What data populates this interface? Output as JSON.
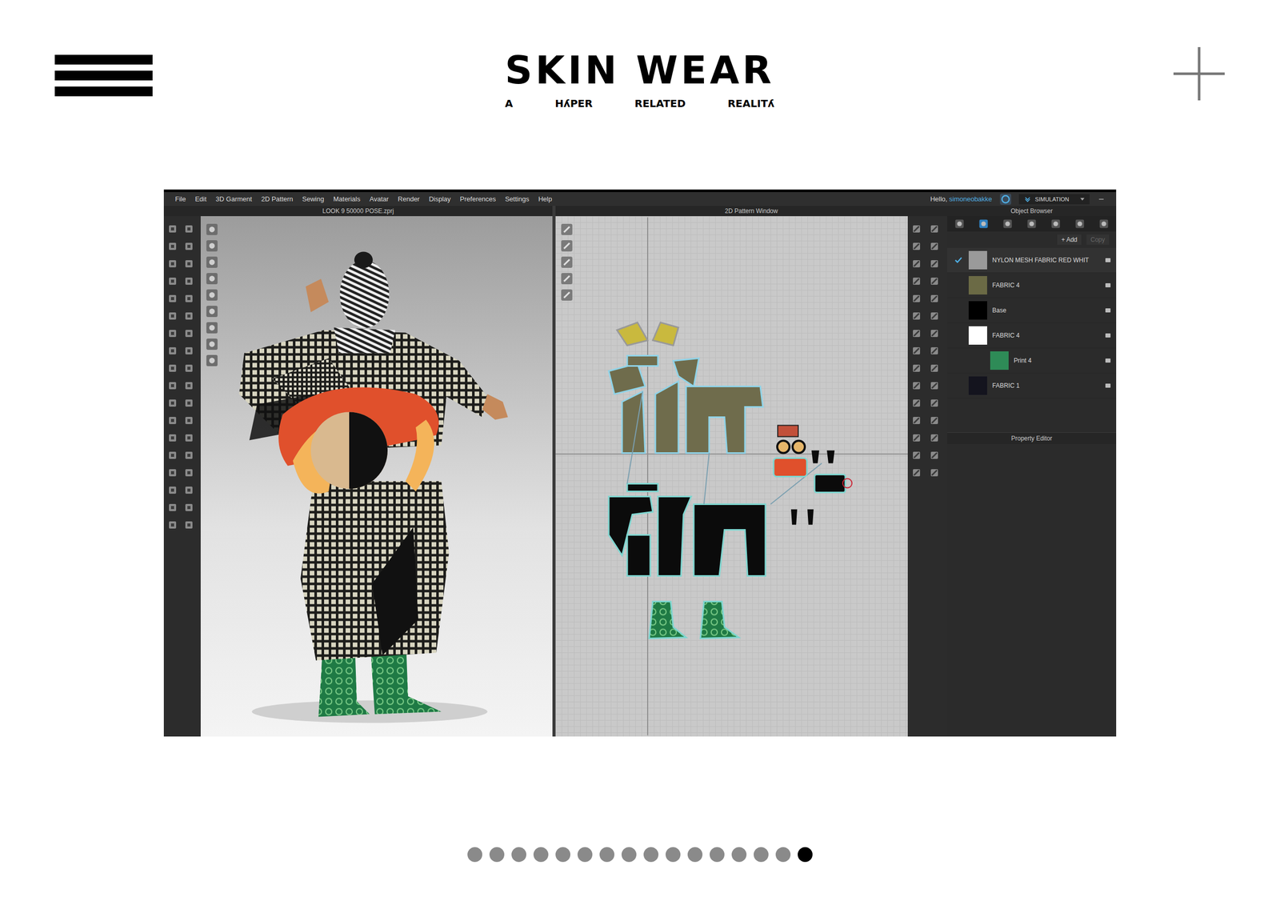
{
  "header": {
    "logo": "SKIN WEAR",
    "tagline": [
      "A",
      "HʎPER",
      "RELATED",
      "REALITʎ"
    ]
  },
  "app": {
    "menu": [
      "File",
      "Edit",
      "3D Garment",
      "2D Pattern",
      "Sewing",
      "Materials",
      "Avatar",
      "Render",
      "Display",
      "Preferences",
      "Settings",
      "Help"
    ],
    "greeting": "Hello,",
    "user": "simoneobakke",
    "mode": "SIMULATION",
    "viewport_title": "LOOK 9 50000 POSE.zprj",
    "pattern_title": "2D Pattern Window",
    "object_browser": {
      "title": "Object Browser",
      "add": "+ Add",
      "copy": {
        "label": "Copy",
        "disabled": true
      },
      "materials": [
        {
          "name": "NYLON MESH FABRIC RED WHIT",
          "selected": true,
          "color": "#9a9a9a",
          "kind": "fabric"
        },
        {
          "name": "FABRIC 4",
          "selected": false,
          "color": "#6b6a45",
          "kind": "fabric"
        },
        {
          "name": "Base",
          "selected": false,
          "color": "#000000",
          "kind": "fabric"
        },
        {
          "name": "FABRIC 4",
          "selected": false,
          "color": "#ffffff",
          "kind": "fabric"
        },
        {
          "name": "Print 4",
          "selected": false,
          "color": "#2e8b57",
          "kind": "print"
        },
        {
          "name": "FABRIC 1",
          "selected": false,
          "color": "#14141e",
          "kind": "fabric"
        }
      ]
    },
    "property_editor": "Property Editor"
  },
  "carousel": [
    {
      "selected": false
    },
    {
      "selected": false
    },
    {
      "selected": false
    },
    {
      "selected": false
    },
    {
      "selected": false
    },
    {
      "selected": false
    },
    {
      "selected": false
    },
    {
      "selected": false
    },
    {
      "selected": false
    },
    {
      "selected": false
    },
    {
      "selected": false
    },
    {
      "selected": false
    },
    {
      "selected": false
    },
    {
      "selected": false
    },
    {
      "selected": false
    },
    {
      "selected": true
    }
  ]
}
